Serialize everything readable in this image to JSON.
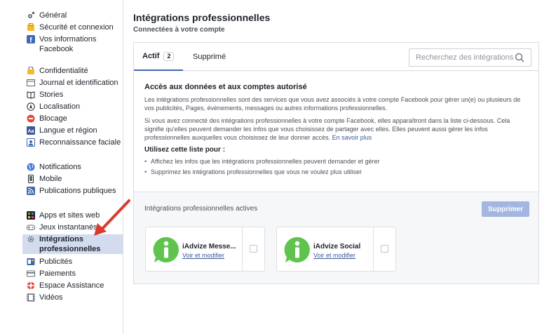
{
  "sidebar": {
    "group1": [
      {
        "label": "Général",
        "icon": "gear-icon"
      },
      {
        "label": "Sécurité et connexion",
        "icon": "shield-icon"
      },
      {
        "label": "Vos informations Facebook",
        "icon": "facebook-icon"
      }
    ],
    "group2": [
      {
        "label": "Confidentialité",
        "icon": "lock-icon"
      },
      {
        "label": "Journal et identification",
        "icon": "timeline-icon"
      },
      {
        "label": "Stories",
        "icon": "book-icon"
      },
      {
        "label": "Localisation",
        "icon": "location-icon"
      },
      {
        "label": "Blocage",
        "icon": "block-icon"
      },
      {
        "label": "Langue et région",
        "icon": "language-icon"
      },
      {
        "label": "Reconnaissance faciale",
        "icon": "face-icon"
      }
    ],
    "group3": [
      {
        "label": "Notifications",
        "icon": "globe-icon"
      },
      {
        "label": "Mobile",
        "icon": "mobile-icon"
      },
      {
        "label": "Publications publiques",
        "icon": "rss-icon"
      }
    ],
    "group4": [
      {
        "label": "Apps et sites web",
        "icon": "apps-icon"
      },
      {
        "label": "Jeux instantanés",
        "icon": "gamepad-icon"
      },
      {
        "label": "Intégrations professionnelles",
        "icon": "business-gear-icon"
      },
      {
        "label": "Publicités",
        "icon": "ads-icon"
      },
      {
        "label": "Paiements",
        "icon": "card-icon"
      },
      {
        "label": "Espace Assistance",
        "icon": "lifebuoy-icon"
      },
      {
        "label": "Vidéos",
        "icon": "film-icon"
      }
    ]
  },
  "main": {
    "title": "Intégrations professionnelles",
    "subtitle": "Connectées à votre compte",
    "tabs": {
      "active_label": "Actif",
      "active_count": "2",
      "removed_label": "Supprimé"
    },
    "search": {
      "placeholder": "Recherchez des intégrations"
    },
    "info": {
      "heading": "Accès aux données et aux comptes autorisé",
      "para1": "Les intégrations professionnelles sont des services que vous avez associés à votre compte Facebook pour gérer un(e) ou plusieurs de vos publicités, Pages, évènements, messages ou autres informations professionnelles.",
      "para2": "Si vous avez connecté des intégrations professionnelles à votre compte Facebook, elles apparaîtront dans la liste ci-dessous. Cela signifie qu’elles peuvent demander les infos que vous choisissez de partager avec elles. Elles peuvent aussi gérer les infos professionnelles auxquelles vous choisissez de leur donner accès.",
      "learn_more": "En savoir plus",
      "list_lead": "Utilisez cette liste pour :",
      "bullets": [
        "Affichez les infos que les intégrations professionnelles peuvent demander et gérer",
        "Supprimez les intégrations professionnelles que vous ne voulez plus utiliser"
      ]
    },
    "active_section": {
      "title": "Intégrations professionnelles actives",
      "remove_button": "Supprimer"
    },
    "cards": [
      {
        "name": "iAdvize Messe...",
        "link": "Voir et modifier"
      },
      {
        "name": "iAdvize Social",
        "link": "Voir et modifier"
      }
    ]
  },
  "colors": {
    "accent": "#4267b2",
    "link": "#365899",
    "active_item_bg": "#d3dcee",
    "disabled_button": "#a2b6e0",
    "iadvize_green": "#5fc44e",
    "arrow_red": "#d93a2b"
  }
}
